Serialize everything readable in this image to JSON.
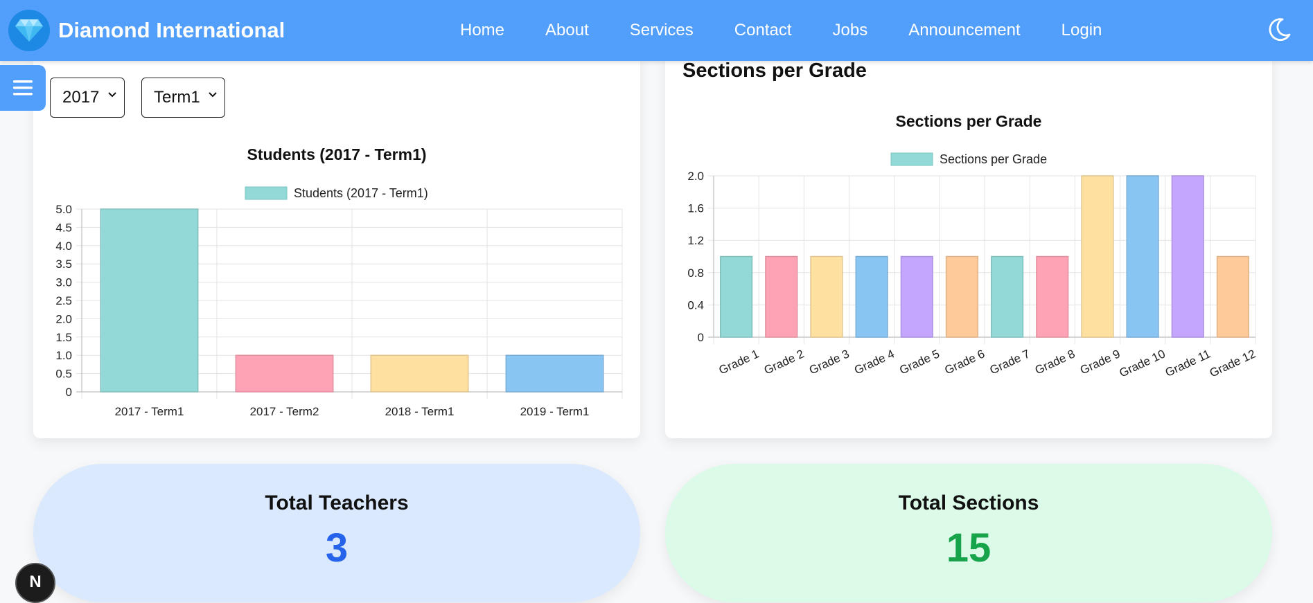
{
  "header": {
    "brand": "Diamond International",
    "logo_icon": "diamond-icon",
    "nav": [
      "Home",
      "About",
      "Services",
      "Contact",
      "Jobs",
      "Announcement",
      "Login"
    ],
    "theme_icon": "moon-icon",
    "color": "#529efb"
  },
  "sidebar_toggle": {
    "icon": "hamburger-menu-icon"
  },
  "filters": {
    "year": "2017",
    "term": "Term1"
  },
  "right_card": {
    "heading": "Sections per Grade"
  },
  "stats": {
    "teachers": {
      "label": "Total Teachers",
      "value": "3",
      "color": "#2563eb"
    },
    "sections": {
      "label": "Total Sections",
      "value": "15",
      "color": "#16a34a"
    }
  },
  "badge": {
    "letter": "N"
  },
  "chart_data": [
    {
      "type": "bar",
      "title": "Students (2017 - Term1)",
      "categories": [
        "2017 - Term1",
        "2017 - Term2",
        "2018 - Term1",
        "2019 - Term1"
      ],
      "series": [
        {
          "name": "Students (2017 - Term1)",
          "values": [
            5,
            1,
            1,
            1
          ]
        }
      ],
      "ylim": [
        0,
        5
      ],
      "yticks": [
        "5.0",
        "4.5",
        "4.0",
        "3.5",
        "3.0",
        "2.5",
        "2.0",
        "1.5",
        "1.0",
        "0.5",
        "0"
      ],
      "grid": true,
      "legend": "top",
      "colors": [
        "#93d9d7",
        "#fea3b5",
        "#fee0a0",
        "#89c5f2"
      ]
    },
    {
      "type": "bar",
      "title": "Sections per Grade",
      "categories": [
        "Grade 1",
        "Grade 2",
        "Grade 3",
        "Grade 4",
        "Grade 5",
        "Grade 6",
        "Grade 7",
        "Grade 8",
        "Grade 9",
        "Grade 10",
        "Grade 11",
        "Grade 12"
      ],
      "series": [
        {
          "name": "Sections per Grade",
          "values": [
            1,
            1,
            1,
            1,
            1,
            1,
            1,
            1,
            2,
            2,
            2,
            1
          ]
        }
      ],
      "ylim": [
        0,
        2
      ],
      "yticks": [
        "2.0",
        "1.6",
        "1.2",
        "0.8",
        "0.4",
        "0"
      ],
      "grid": true,
      "legend": "top",
      "colors": [
        "#93d9d7",
        "#fea3b5",
        "#fee0a0",
        "#89c5f2",
        "#c4a6fe",
        "#feca9a",
        "#93d9d7",
        "#fea3b5",
        "#fee0a0",
        "#89c5f2",
        "#c4a6fe",
        "#feca9a"
      ]
    }
  ]
}
